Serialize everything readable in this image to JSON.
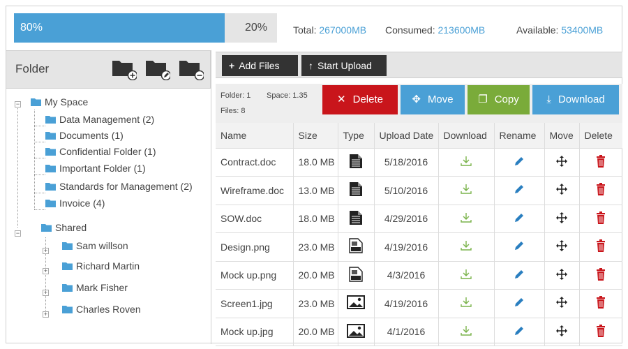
{
  "quota": {
    "used_label": "80%",
    "free_label": "20%",
    "used_fraction": 0.8,
    "total_label": "Total:",
    "total_value": "267000MB",
    "consumed_label": "Consumed:",
    "consumed_value": "213600MB",
    "available_label": "Available:",
    "available_value": "53400MB"
  },
  "sidebar": {
    "title": "Folder",
    "icons": [
      "add-folder-icon",
      "rename-folder-icon",
      "remove-folder-icon"
    ],
    "tree": {
      "my_space": {
        "label": "My Space",
        "children": [
          "Data Management (2)",
          "Documents (1)",
          "Confidential Folder (1)",
          "Important Folder (1)",
          "Standards for Management (2)",
          "Invoice (4)"
        ]
      },
      "shared": {
        "label": "Shared",
        "children": [
          "Sam willson",
          "Richard Martin",
          "Mark Fisher",
          "Charles Roven"
        ]
      }
    }
  },
  "toolbar": {
    "add_files": "Add Files",
    "start_upload": "Start Upload"
  },
  "info": {
    "folder": "Folder: 1",
    "space": "Space: 1.35",
    "files": "Files: 8"
  },
  "actions": {
    "delete": "Delete",
    "move": "Move",
    "copy": "Copy",
    "download": "Download"
  },
  "colors": {
    "accent_blue": "#4aa0d6",
    "delete_red": "#c9151b",
    "copy_green": "#7aab3a",
    "download_green": "#7ab34b",
    "toolbar_dark": "#333333"
  },
  "table": {
    "headers": [
      "Name",
      "Size",
      "Type",
      "Upload Date",
      "Download",
      "Rename",
      "Move",
      "Delete"
    ],
    "rows": [
      {
        "name": "Contract.doc",
        "size": "18.0 MB",
        "type": "document-icon",
        "date": "5/18/2016"
      },
      {
        "name": "Wireframe.doc",
        "size": "13.0 MB",
        "type": "document-icon",
        "date": "5/10/2016"
      },
      {
        "name": "SOW.doc",
        "size": "18.0 MB",
        "type": "document-icon",
        "date": "4/29/2016"
      },
      {
        "name": "Design.png",
        "size": "23.0 MB",
        "type": "png-file-icon",
        "date": "4/19/2016"
      },
      {
        "name": "Mock up.png",
        "size": "20.0 MB",
        "type": "png-file-icon",
        "date": "4/3/2016"
      },
      {
        "name": "Screen1.jpg",
        "size": "23.0 MB",
        "type": "image-icon",
        "date": "4/19/2016"
      },
      {
        "name": "Mock up.jpg",
        "size": "20.0 MB",
        "type": "image-icon",
        "date": "4/1/2016"
      }
    ]
  }
}
